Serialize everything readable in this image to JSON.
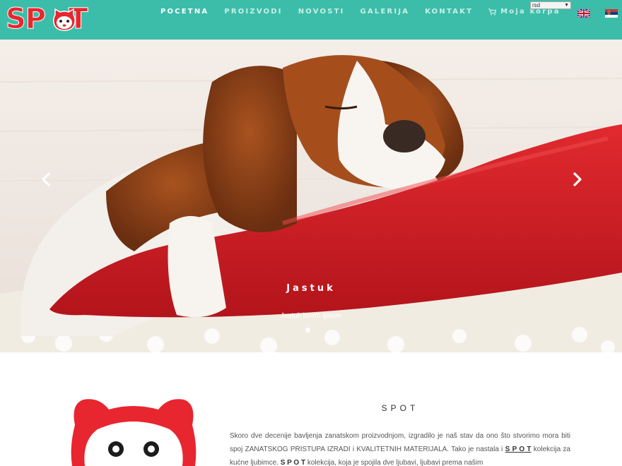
{
  "brand": {
    "logo_text": "SPOT",
    "accent": "#e8262f",
    "header_bg": "#3cbda9"
  },
  "nav": {
    "items": [
      {
        "label": "POCETNA",
        "active": true
      },
      {
        "label": "PROIZVODI",
        "active": false
      },
      {
        "label": "NOVOSTI",
        "active": false
      },
      {
        "label": "GALERIJA",
        "active": false
      },
      {
        "label": "KONTAKT",
        "active": false
      }
    ],
    "cart_label": "Moja korpa",
    "cart_icon": "cart-icon"
  },
  "currency": {
    "selected": "rsd"
  },
  "languages": [
    {
      "name": "english-flag-icon"
    },
    {
      "name": "serbian-flag-icon"
    }
  ],
  "hero": {
    "title": "Jastuk",
    "subtitle": "Jastuk lorem ipsum",
    "prev_icon": "chevron-left-icon",
    "next_icon": "chevron-right-icon",
    "slide_count": 2,
    "active_slide": 1
  },
  "about": {
    "heading": "SPOT",
    "para_1": "Skoro dve decenije bavljenja zanatskom proizvodnjom, izgradilo je naš stav da ono što stvorimo mora biti spoj ZANATSKOG PRISTUPA IZRADI i KVALITETNIH MATERIJALA. Tako je nastala i ",
    "spot_a": "S P O T",
    "para_2": " kolekcija za kućne ljubimce. ",
    "spot_b": "S P O T",
    "para_3": " kolekcija, koja je spojila dve ljubavi, ljubavi prema našim"
  }
}
